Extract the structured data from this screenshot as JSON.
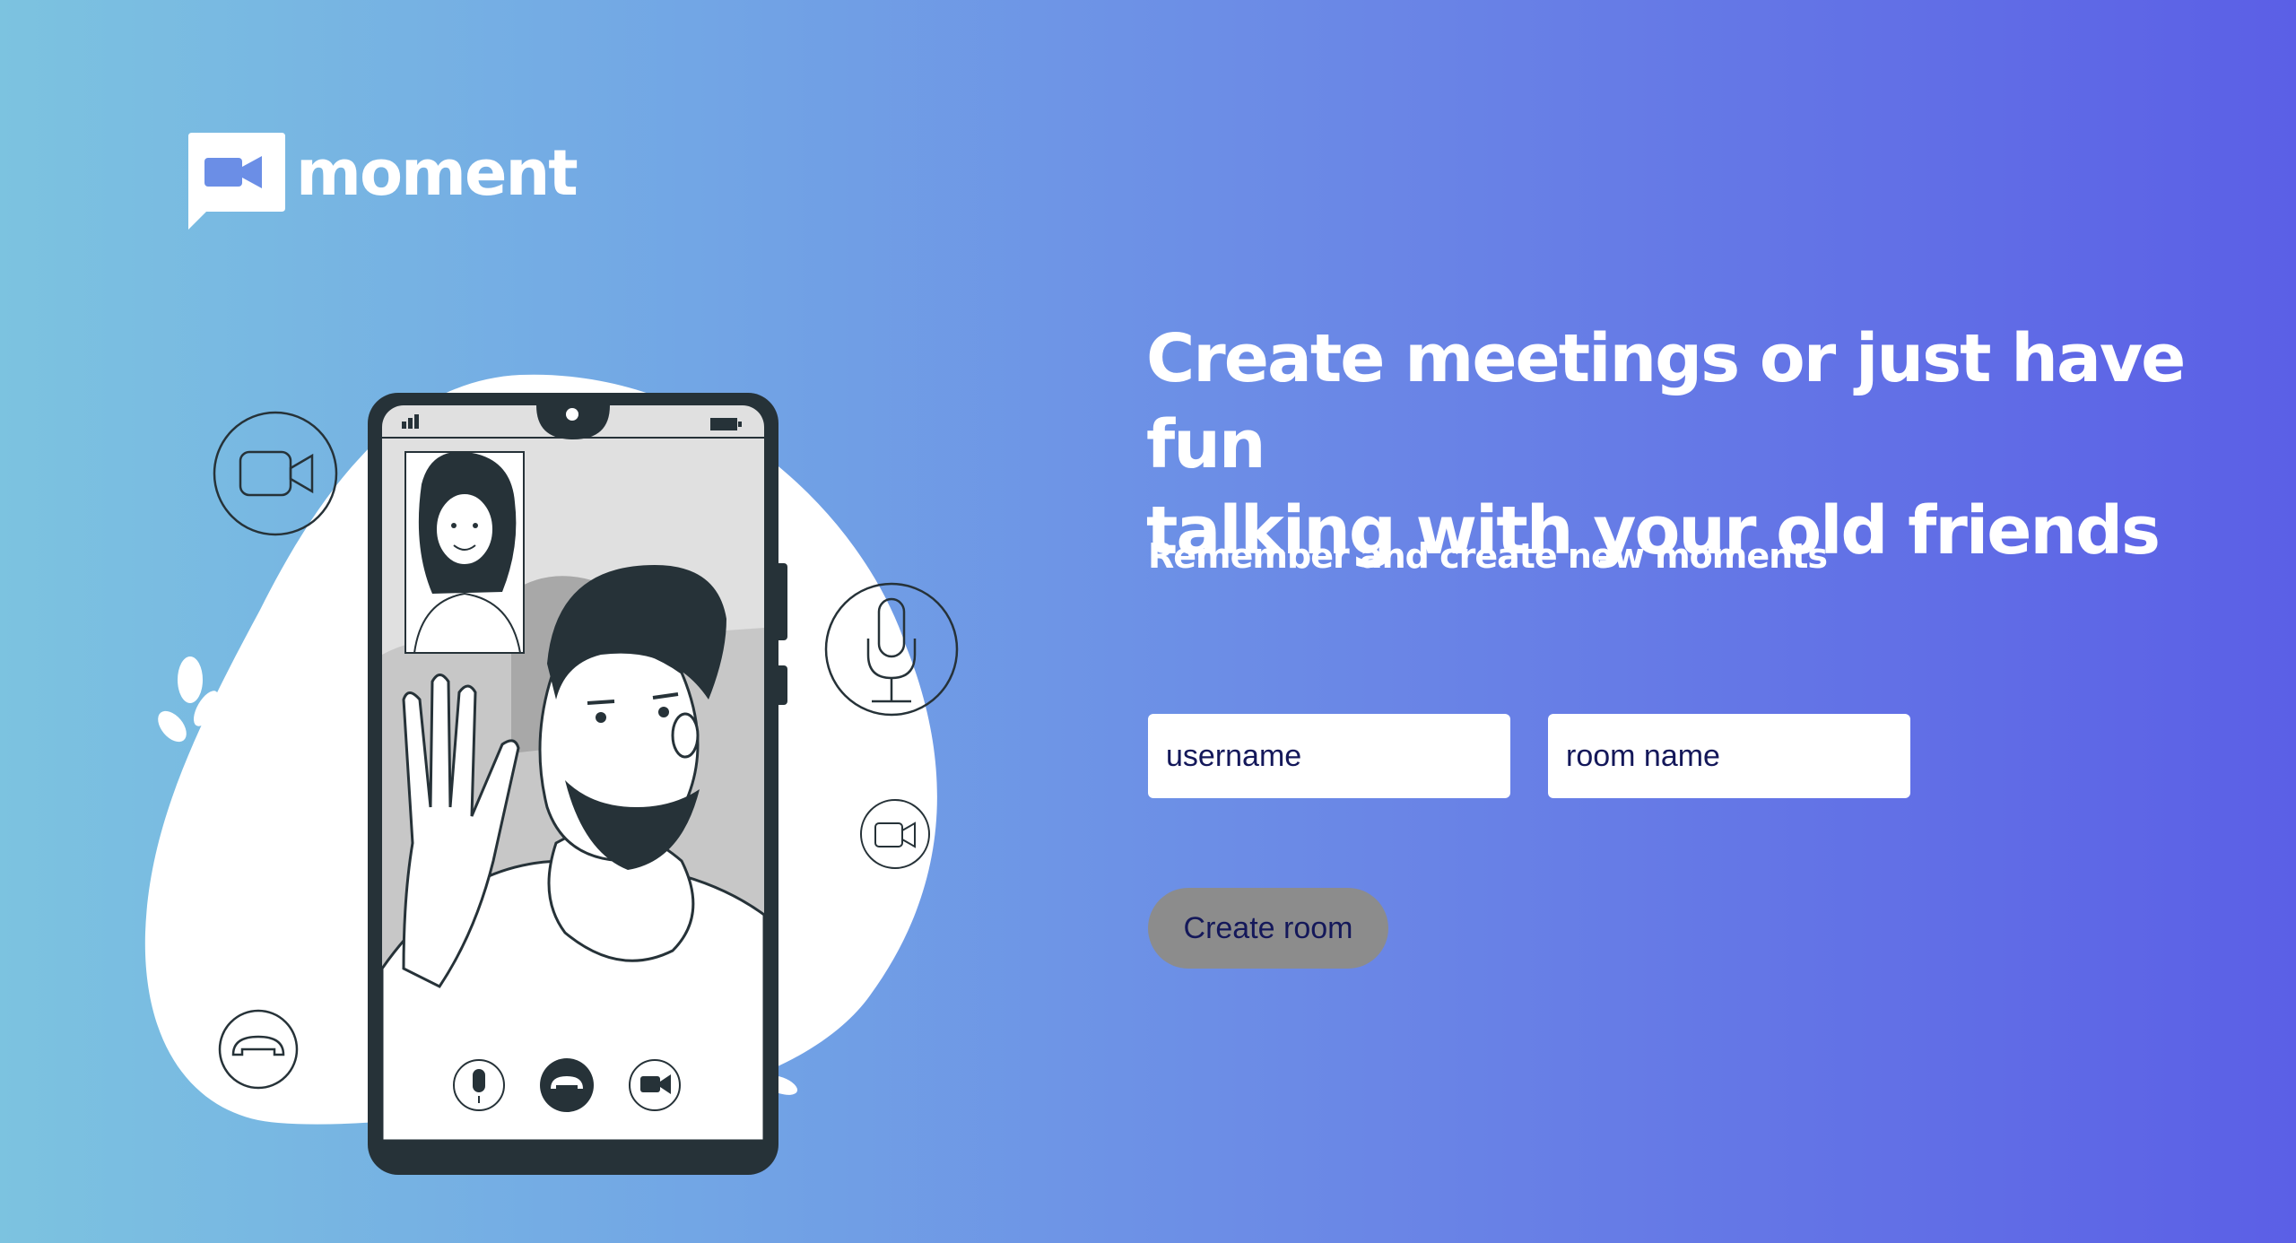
{
  "brand": {
    "name": "moment",
    "logo_icon": "video-chat-bubble-icon"
  },
  "hero": {
    "headline_line1": "Create meetings or just have fun",
    "headline_line2": "talking with your old friends",
    "subline": "Remember and create new moments"
  },
  "form": {
    "username_placeholder": "username",
    "username_value": "",
    "room_placeholder": "room name",
    "room_value": "",
    "create_label": "Create room"
  },
  "illustration": {
    "subject": "video-call-phone-illustration",
    "icons": [
      "video-camera-icon",
      "microphone-icon",
      "hang-up-icon",
      "signal-icon",
      "battery-icon"
    ]
  },
  "colors": {
    "gradient_start": "#7cc3e0",
    "gradient_end": "#5b5fe6",
    "button_bg": "#8c8c8c",
    "phone_frame": "#263238",
    "text_dark": "#14185a"
  }
}
